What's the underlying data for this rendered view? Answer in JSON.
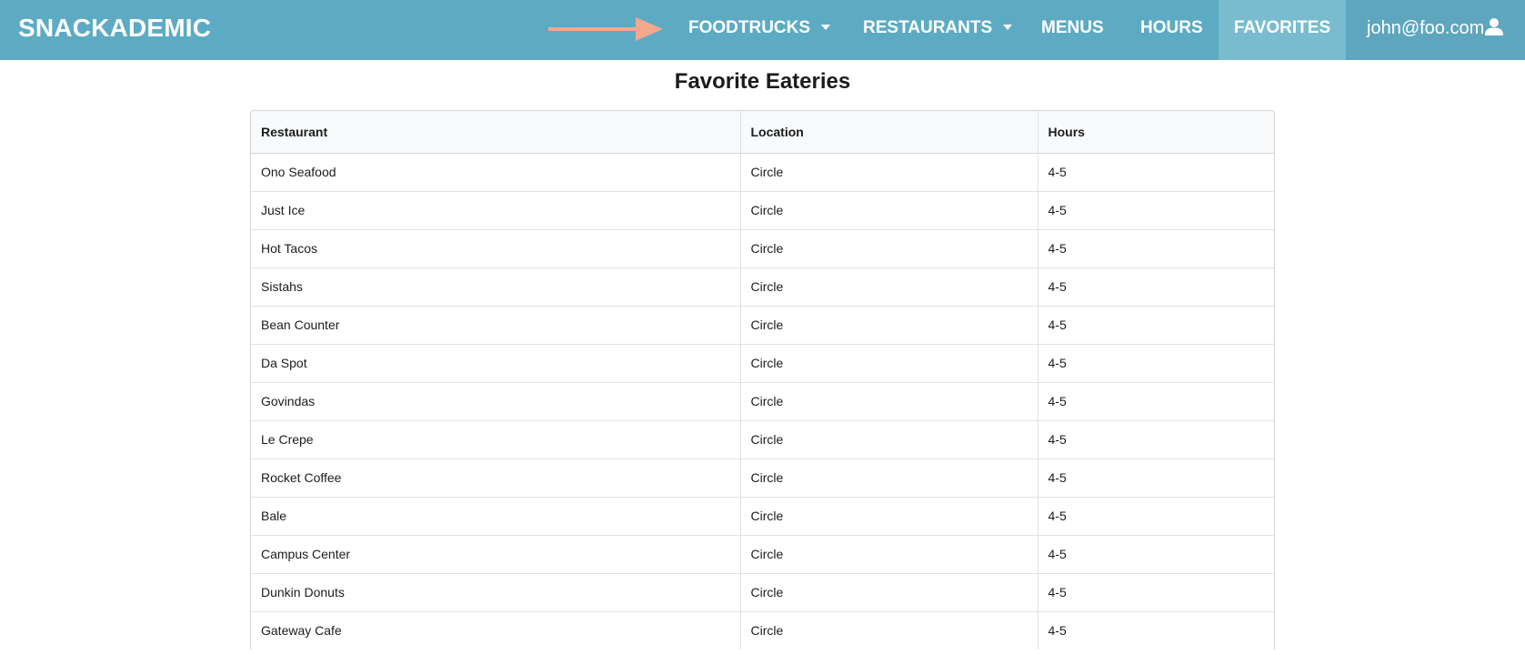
{
  "brand": "SNACKADEMIC",
  "nav": {
    "foodtrucks": "FOODTRUCKS",
    "restaurants": "RESTAURANTS",
    "menus": "MENUS",
    "hours": "HOURS",
    "favorites": "FAVORITES",
    "user": "john@foo.com"
  },
  "icons": {
    "arrow": "arrow-right-icon",
    "dropdown": "caret-down-icon",
    "user": "user-icon"
  },
  "colors": {
    "navbar": "#5dabc3",
    "active_tab": "#79bccf",
    "arrow": "#f4a88e"
  },
  "page_title": "Favorite Eateries",
  "table": {
    "headers": [
      "Restaurant",
      "Location",
      "Hours"
    ],
    "rows": [
      [
        "Ono Seafood",
        "Circle",
        "4-5"
      ],
      [
        "Just Ice",
        "Circle",
        "4-5"
      ],
      [
        "Hot Tacos",
        "Circle",
        "4-5"
      ],
      [
        "Sistahs",
        "Circle",
        "4-5"
      ],
      [
        "Bean Counter",
        "Circle",
        "4-5"
      ],
      [
        "Da Spot",
        "Circle",
        "4-5"
      ],
      [
        "Govindas",
        "Circle",
        "4-5"
      ],
      [
        "Le Crepe",
        "Circle",
        "4-5"
      ],
      [
        "Rocket Coffee",
        "Circle",
        "4-5"
      ],
      [
        "Bale",
        "Circle",
        "4-5"
      ],
      [
        "Campus Center",
        "Circle",
        "4-5"
      ],
      [
        "Dunkin Donuts",
        "Circle",
        "4-5"
      ],
      [
        "Gateway Cafe",
        "Circle",
        "4-5"
      ]
    ]
  }
}
